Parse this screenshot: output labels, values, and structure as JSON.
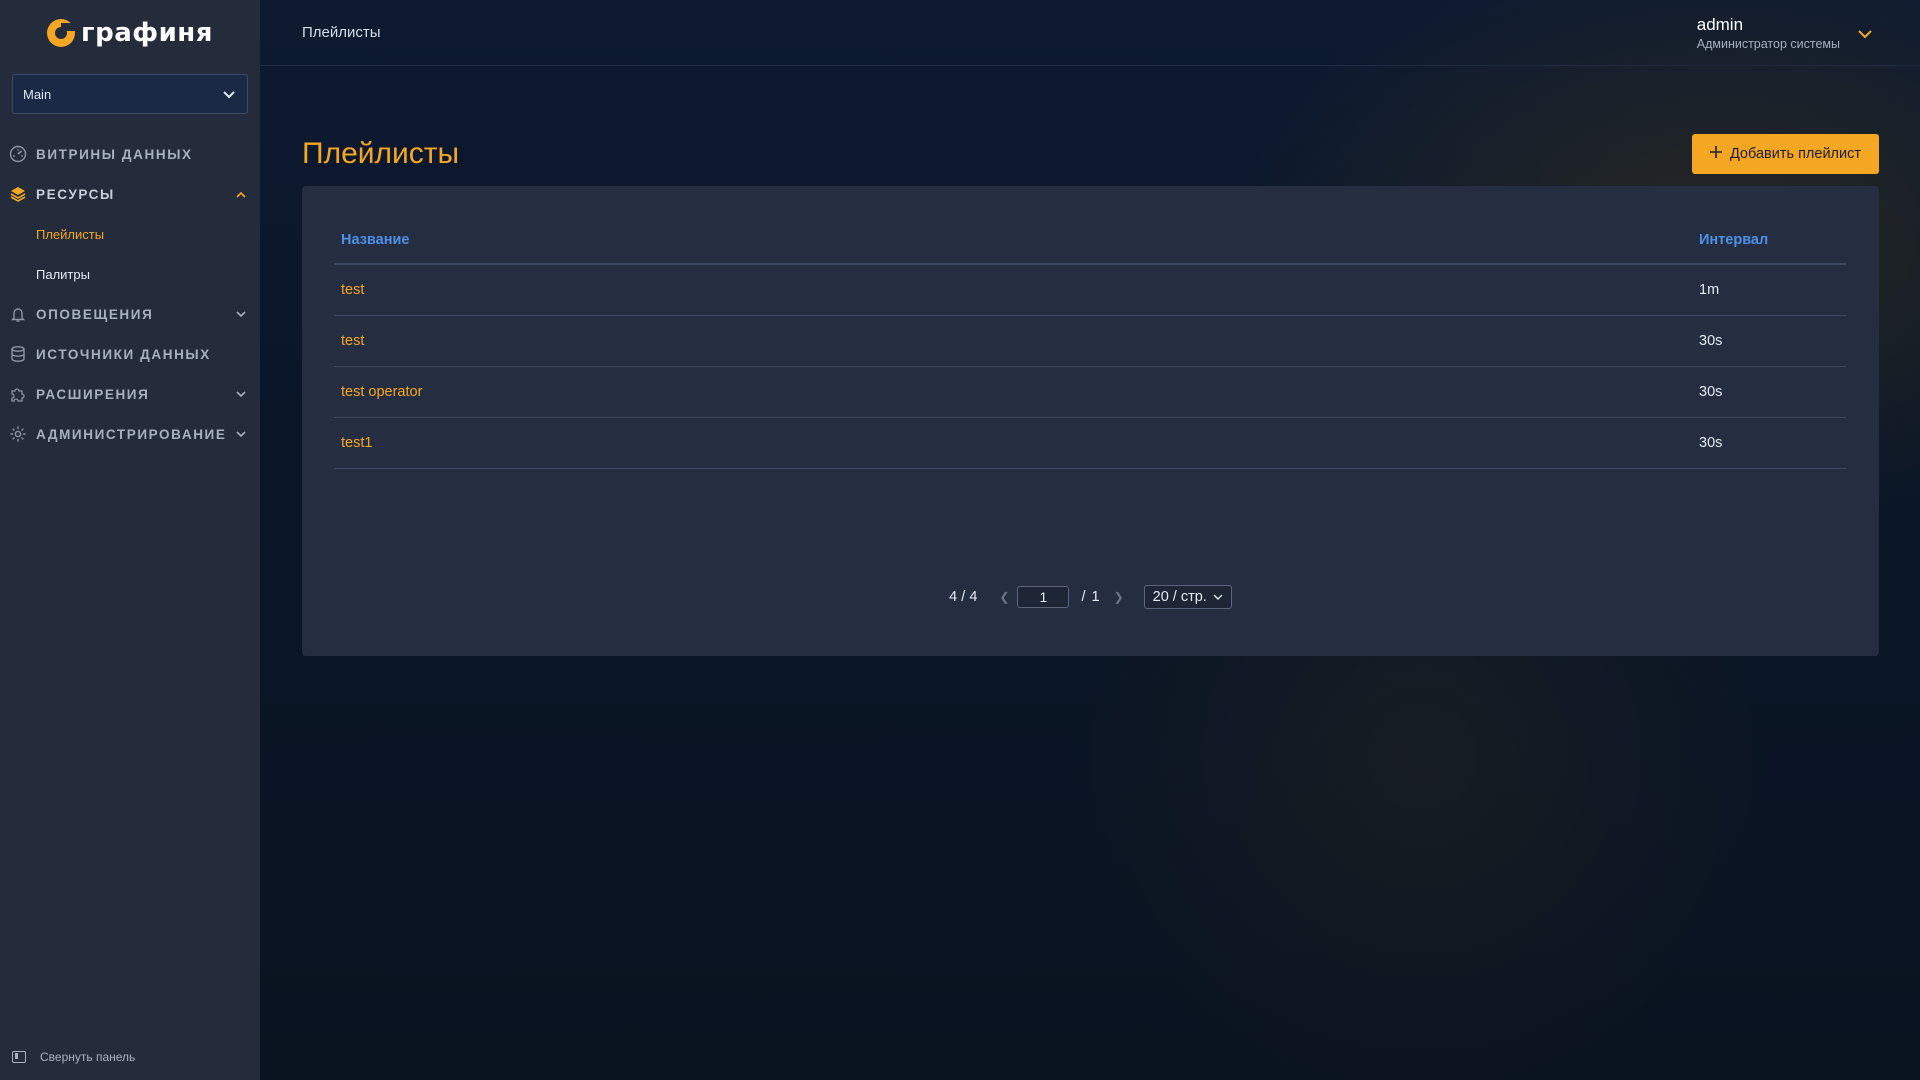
{
  "brand": {
    "name": "графиня",
    "accent": "#f5a623"
  },
  "org": {
    "selected": "Main"
  },
  "nav": {
    "items": [
      {
        "label": "ВИТРИНЫ ДАННЫХ",
        "icon": "dashboard-icon",
        "expandable": false
      },
      {
        "label": "РЕСУРСЫ",
        "icon": "layers-icon",
        "expandable": true,
        "expanded": true,
        "children": [
          {
            "label": "Плейлисты",
            "active": true
          },
          {
            "label": "Палитры",
            "active": false
          }
        ]
      },
      {
        "label": "ОПОВЕЩЕНИЯ",
        "icon": "bell-icon",
        "expandable": true
      },
      {
        "label": "ИСТОЧНИКИ ДАННЫХ",
        "icon": "database-icon",
        "expandable": false
      },
      {
        "label": "РАСШИРЕНИЯ",
        "icon": "puzzle-icon",
        "expandable": true
      },
      {
        "label": "АДМИНИСТРИРОВАНИЕ",
        "icon": "gear-icon",
        "expandable": true
      }
    ],
    "collapse_label": "Свернуть панель"
  },
  "header": {
    "breadcrumb": "Плейлисты",
    "user": {
      "name": "admin",
      "role": "Администратор системы"
    }
  },
  "page": {
    "title": "Плейлисты",
    "add_button": "Добавить плейлист"
  },
  "table": {
    "columns": {
      "name": "Название",
      "interval": "Интервал"
    },
    "rows": [
      {
        "name": "test",
        "interval": "1m"
      },
      {
        "name": "test",
        "interval": "30s"
      },
      {
        "name": "test operator",
        "interval": "30s"
      },
      {
        "name": "test1",
        "interval": "30s"
      }
    ]
  },
  "pagination": {
    "total": "4 / 4",
    "current_page": "1",
    "separator": "/",
    "page_count": "1",
    "page_size": "20 / стр."
  }
}
